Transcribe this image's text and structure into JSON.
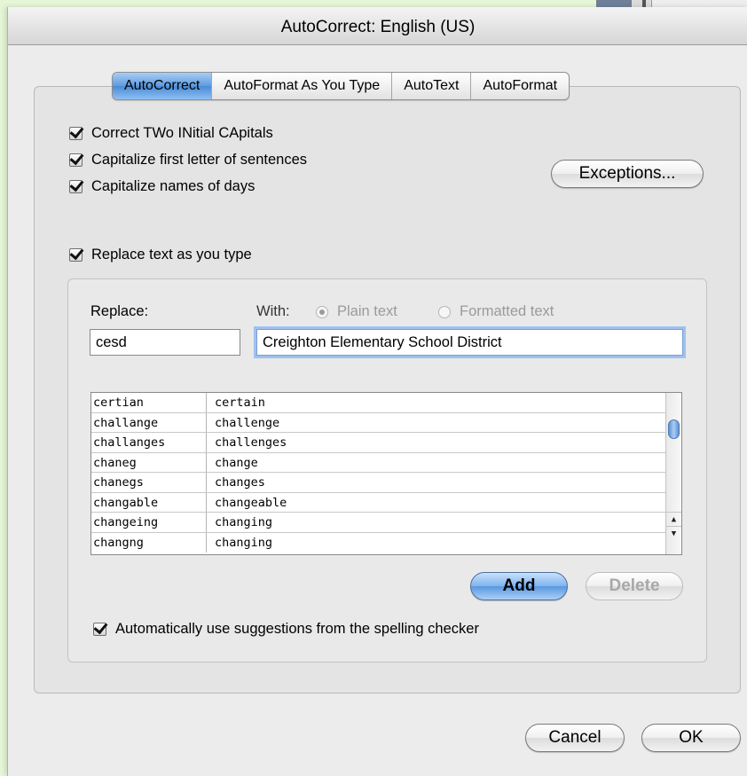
{
  "window": {
    "title": "AutoCorrect: English (US)"
  },
  "tabs": [
    {
      "label": "AutoCorrect",
      "active": true
    },
    {
      "label": "AutoFormat As You Type",
      "active": false
    },
    {
      "label": "AutoText",
      "active": false
    },
    {
      "label": "AutoFormat",
      "active": false
    }
  ],
  "options": {
    "correct_two_initial": {
      "label": "Correct TWo INitial CApitals",
      "checked": true
    },
    "capitalize_first": {
      "label": "Capitalize first letter of sentences",
      "checked": true
    },
    "capitalize_days": {
      "label": "Capitalize names of days",
      "checked": true
    },
    "replace_as_you_type": {
      "label": "Replace text as you type",
      "checked": true
    },
    "use_spelling_suggestions": {
      "label": "Automatically use suggestions from the spelling checker",
      "checked": true
    }
  },
  "buttons": {
    "exceptions": "Exceptions...",
    "add": "Add",
    "delete": "Delete",
    "cancel": "Cancel",
    "ok": "OK"
  },
  "replace": {
    "replace_label": "Replace:",
    "with_label": "With:",
    "plain_text_label": "Plain text",
    "formatted_text_label": "Formatted text",
    "selected_format": "Plain text",
    "replace_value": "cesd",
    "with_value": "Creighton Elementary School District"
  },
  "entries": [
    {
      "from": "certian",
      "to": "certain"
    },
    {
      "from": "challange",
      "to": "challenge"
    },
    {
      "from": "challanges",
      "to": "challenges"
    },
    {
      "from": "chaneg",
      "to": "change"
    },
    {
      "from": "chanegs",
      "to": "changes"
    },
    {
      "from": "changable",
      "to": "changeable"
    },
    {
      "from": "changeing",
      "to": "changing"
    },
    {
      "from": "changng",
      "to": "changing"
    }
  ],
  "colors": {
    "desktop": "#e6f7d8",
    "accent_blue": "#5d9be0",
    "window_bg": "#ececec"
  }
}
